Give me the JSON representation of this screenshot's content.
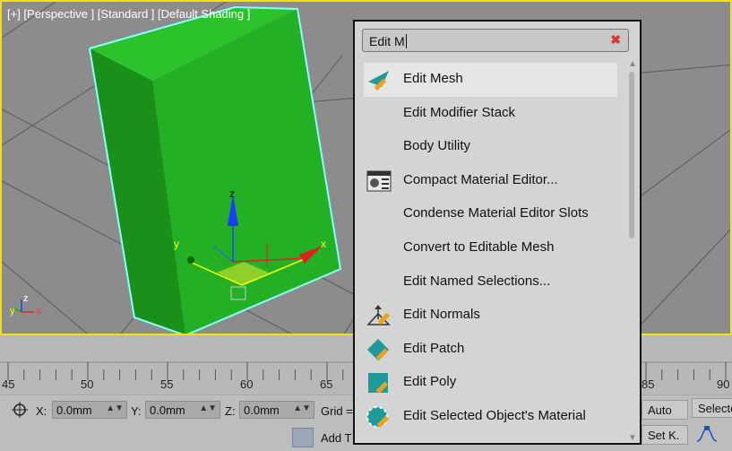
{
  "viewport": {
    "label": "[+] [Perspective ] [Standard ] [Default Shading ]",
    "axis_x": "x",
    "axis_y": "y",
    "axis_z": "z",
    "corner_x": "x",
    "corner_y": "y",
    "corner_z": "z"
  },
  "timeline": {
    "ticks": [
      "45",
      "50",
      "55",
      "60",
      "65",
      "85",
      "90"
    ]
  },
  "coords": {
    "x_label": "X:",
    "x_value": "0.0mm",
    "y_label": "Y:",
    "y_value": "0.0mm",
    "z_label": "Z:",
    "z_value": "0.0mm",
    "grid_label": "Grid =",
    "add_time_tag": "Add T",
    "auto_label": "Auto",
    "selected_label": "Selecte",
    "set_key_label": "Set K."
  },
  "popup": {
    "search_value": "Edit M",
    "clear_icon": "✖",
    "items": [
      {
        "label": "Edit Mesh",
        "icon": "edit-mesh-icon"
      },
      {
        "label": "Edit Modifier Stack",
        "icon": ""
      },
      {
        "label": "Body Utility",
        "icon": ""
      },
      {
        "label": "Compact Material Editor...",
        "icon": "material-editor-icon"
      },
      {
        "label": "Condense Material Editor Slots",
        "icon": ""
      },
      {
        "label": "Convert to Editable Mesh",
        "icon": ""
      },
      {
        "label": "Edit Named Selections...",
        "icon": ""
      },
      {
        "label": "Edit Normals",
        "icon": "edit-normals-icon"
      },
      {
        "label": "Edit Patch",
        "icon": "edit-patch-icon"
      },
      {
        "label": "Edit Poly",
        "icon": "edit-poly-icon"
      },
      {
        "label": "Edit Selected Object's Material",
        "icon": "material-ball-icon"
      }
    ]
  },
  "colors": {
    "box": "#22b022",
    "highlight": "#f2e600",
    "accent": "#1f9a9a"
  }
}
